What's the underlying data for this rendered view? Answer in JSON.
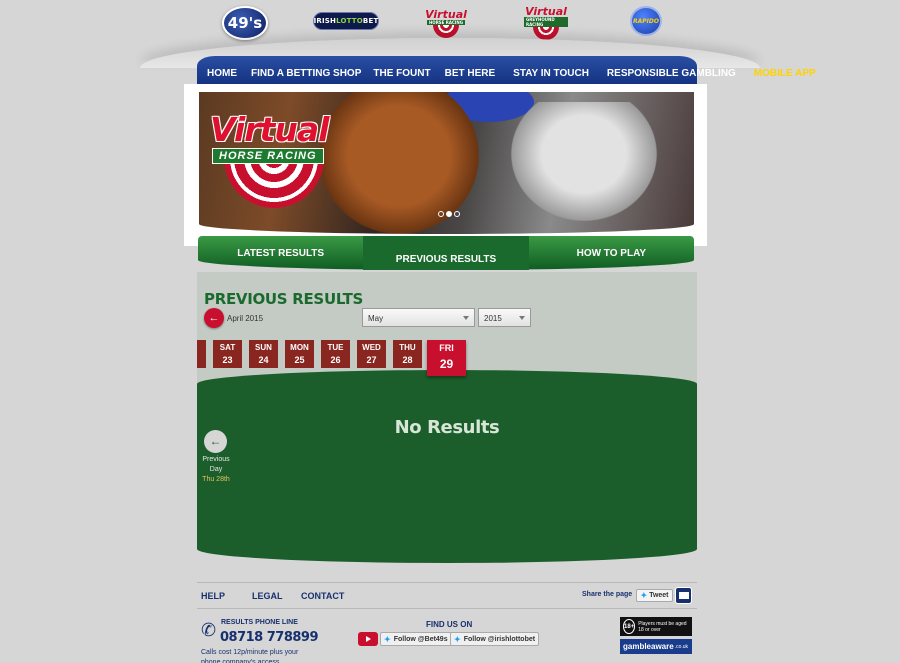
{
  "logos": {
    "l49s": "49's",
    "irish_a": "IRISH",
    "irish_b": "LOTTO",
    "irish_c": "BET",
    "virtual": "Virtual",
    "virtual_sub1": "HORSE RACING",
    "virtual_sub2": "GREYHOUND RACING",
    "rapido": "RAPIDO"
  },
  "nav": {
    "items": [
      "HOME",
      "FIND A BETTING SHOP",
      "THE FOUNT",
      "BET HERE",
      "STAY IN TOUCH",
      "RESPONSIBLE GAMBLING"
    ],
    "mobile": "MOBILE APP"
  },
  "banner": {
    "title": "Virtual",
    "subtitle": "HORSE RACING"
  },
  "tabs": [
    "LATEST RESULTS",
    "PREVIOUS RESULTS",
    "HOW TO PLAY"
  ],
  "results": {
    "heading": "PREVIOUS RESULTS",
    "prev_month": "April 2015",
    "month_value": "May",
    "year_value": "2015",
    "days": [
      {
        "dow": "SAT",
        "num": "23"
      },
      {
        "dow": "SUN",
        "num": "24"
      },
      {
        "dow": "MON",
        "num": "25"
      },
      {
        "dow": "TUE",
        "num": "26"
      },
      {
        "dow": "WED",
        "num": "27"
      },
      {
        "dow": "THU",
        "num": "28"
      },
      {
        "dow": "FRI",
        "num": "29"
      }
    ],
    "empty": "No Results",
    "prev_label_1": "Previous",
    "prev_label_2": "Day",
    "prev_date": "Thu 28th"
  },
  "footer": {
    "links": [
      "HELP",
      "LEGAL",
      "CONTACT"
    ],
    "share": "Share the page",
    "tweet": "Tweet",
    "phone_title": "RESULTS PHONE LINE",
    "phone": "08718 778899",
    "calls_note": "Calls cost 12p/minute plus your phone company's access",
    "find_us": "FIND US ON",
    "follow_1": "Follow @Bet49s",
    "follow_2": "Follow @irishlottobet",
    "age_badge": "18+",
    "age_text": "Players must be aged 18 or over",
    "gamble": "gambleaware",
    "gamble_tld": ".co.uk"
  }
}
